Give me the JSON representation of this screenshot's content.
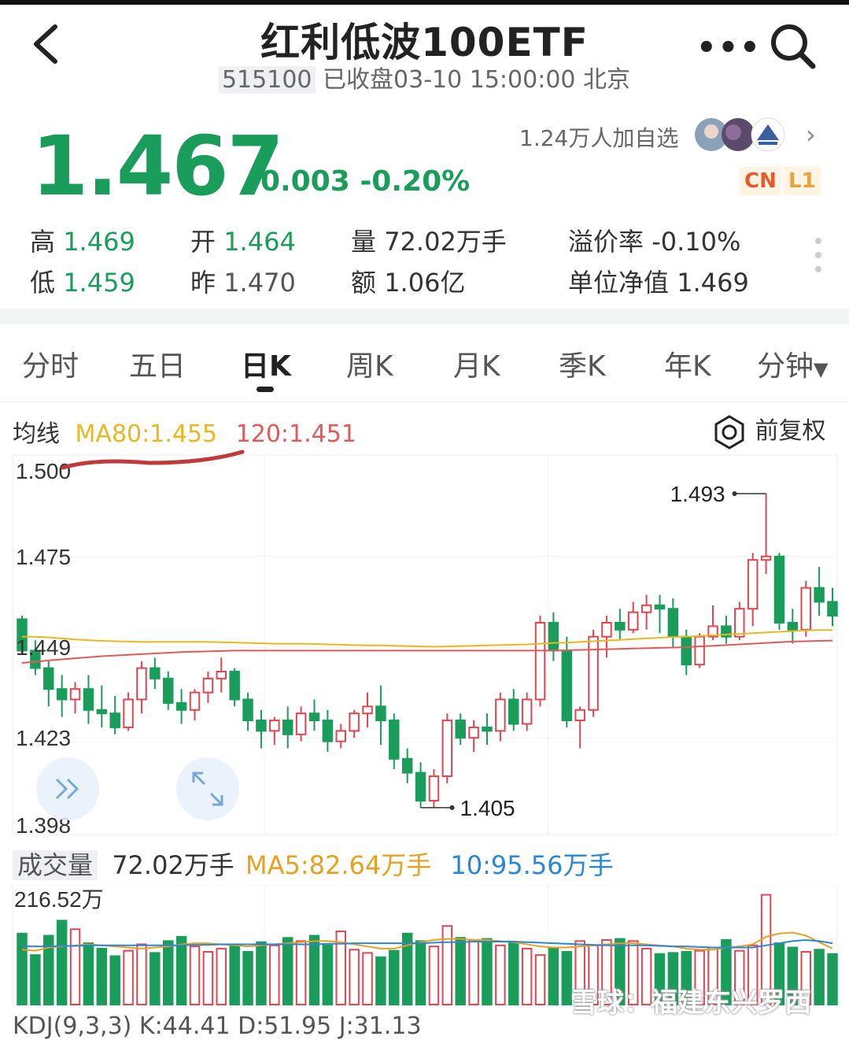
{
  "header": {
    "title": "红利低波100ETF",
    "code": "515100",
    "status": "已收盘03-10 15:00:00 北京"
  },
  "quote": {
    "price": "1.467",
    "change": "-0.003",
    "change_pct": "-0.20%",
    "followers": "1.24万人加自选",
    "badge_cn": "CN",
    "badge_l1": "L1"
  },
  "stats": {
    "high_label": "高",
    "high": "1.469",
    "open_label": "开",
    "open": "1.464",
    "volume_label": "量",
    "volume": "72.02万手",
    "premium_label": "溢价率",
    "premium": "-0.10%",
    "low_label": "低",
    "low": "1.459",
    "prev_label": "昨",
    "prev": "1.470",
    "amount_label": "额",
    "amount": "1.06亿",
    "nav_label": "单位净值",
    "nav": "1.469"
  },
  "tabs": [
    "分时",
    "五日",
    "日K",
    "周K",
    "月K",
    "季K",
    "年K",
    "分钟"
  ],
  "active_tab": "日K",
  "ma": {
    "label": "均线",
    "ma80": "MA80:1.455",
    "ma120": "120:1.451",
    "adjust": "前复权"
  },
  "colors": {
    "up": "#e04552",
    "down": "#1a9c5b",
    "ma80": "#e8b820",
    "ma120": "#e05a5a",
    "vol_ma10": "#2b86d6",
    "note": "#c0393b"
  },
  "chart_data": {
    "type": "candlestick",
    "y_ticks": [
      "1.500",
      "1.475",
      "1.449",
      "1.423",
      "1.398"
    ],
    "ylim": [
      1.398,
      1.5
    ],
    "max_label": "1.493",
    "min_label": "1.405",
    "candles": [
      [
        1.457,
        1.458,
        1.447,
        1.448
      ],
      [
        1.448,
        1.451,
        1.441,
        1.443
      ],
      [
        1.443,
        1.445,
        1.432,
        1.437
      ],
      [
        1.437,
        1.441,
        1.429,
        1.434
      ],
      [
        1.434,
        1.439,
        1.43,
        1.437
      ],
      [
        1.437,
        1.441,
        1.427,
        1.431
      ],
      [
        1.431,
        1.438,
        1.426,
        1.43
      ],
      [
        1.43,
        1.435,
        1.424,
        1.426
      ],
      [
        1.426,
        1.436,
        1.425,
        1.434
      ],
      [
        1.434,
        1.445,
        1.43,
        1.443
      ],
      [
        1.443,
        1.446,
        1.437,
        1.44
      ],
      [
        1.44,
        1.442,
        1.431,
        1.433
      ],
      [
        1.433,
        1.437,
        1.427,
        1.431
      ],
      [
        1.431,
        1.437,
        1.428,
        1.436
      ],
      [
        1.436,
        1.442,
        1.433,
        1.44
      ],
      [
        1.44,
        1.446,
        1.436,
        1.442
      ],
      [
        1.442,
        1.443,
        1.432,
        1.434
      ],
      [
        1.434,
        1.436,
        1.425,
        1.428
      ],
      [
        1.428,
        1.431,
        1.42,
        1.425
      ],
      [
        1.425,
        1.429,
        1.421,
        1.428
      ],
      [
        1.428,
        1.432,
        1.42,
        1.424
      ],
      [
        1.424,
        1.432,
        1.422,
        1.43
      ],
      [
        1.43,
        1.434,
        1.425,
        1.428
      ],
      [
        1.428,
        1.431,
        1.419,
        1.422
      ],
      [
        1.422,
        1.427,
        1.42,
        1.425
      ],
      [
        1.425,
        1.431,
        1.423,
        1.43
      ],
      [
        1.43,
        1.436,
        1.426,
        1.432
      ],
      [
        1.432,
        1.438,
        1.421,
        1.428
      ],
      [
        1.428,
        1.43,
        1.414,
        1.417
      ],
      [
        1.417,
        1.42,
        1.41,
        1.413
      ],
      [
        1.413,
        1.416,
        1.403,
        1.405
      ],
      [
        1.405,
        1.414,
        1.403,
        1.412
      ],
      [
        1.412,
        1.43,
        1.41,
        1.428
      ],
      [
        1.428,
        1.43,
        1.421,
        1.423
      ],
      [
        1.423,
        1.428,
        1.419,
        1.426
      ],
      [
        1.426,
        1.43,
        1.421,
        1.425
      ],
      [
        1.425,
        1.436,
        1.422,
        1.434
      ],
      [
        1.434,
        1.437,
        1.425,
        1.427
      ],
      [
        1.427,
        1.436,
        1.425,
        1.434
      ],
      [
        1.434,
        1.458,
        1.432,
        1.456
      ],
      [
        1.456,
        1.459,
        1.445,
        1.448
      ],
      [
        1.448,
        1.452,
        1.426,
        1.428
      ],
      [
        1.428,
        1.432,
        1.42,
        1.431
      ],
      [
        1.431,
        1.454,
        1.429,
        1.452
      ],
      [
        1.452,
        1.458,
        1.446,
        1.456
      ],
      [
        1.456,
        1.46,
        1.451,
        1.454
      ],
      [
        1.454,
        1.462,
        1.453,
        1.459
      ],
      [
        1.459,
        1.464,
        1.454,
        1.461
      ],
      [
        1.461,
        1.464,
        1.453,
        1.46
      ],
      [
        1.46,
        1.463,
        1.449,
        1.452
      ],
      [
        1.452,
        1.454,
        1.441,
        1.444
      ],
      [
        1.444,
        1.453,
        1.443,
        1.452
      ],
      [
        1.452,
        1.461,
        1.451,
        1.455
      ],
      [
        1.455,
        1.458,
        1.45,
        1.452
      ],
      [
        1.452,
        1.462,
        1.451,
        1.46
      ],
      [
        1.46,
        1.476,
        1.455,
        1.474
      ],
      [
        1.474,
        1.493,
        1.47,
        1.475
      ],
      [
        1.475,
        1.476,
        1.454,
        1.456
      ],
      [
        1.456,
        1.46,
        1.45,
        1.454
      ],
      [
        1.454,
        1.468,
        1.452,
        1.466
      ],
      [
        1.466,
        1.472,
        1.458,
        1.462
      ],
      [
        1.462,
        1.466,
        1.455,
        1.458
      ]
    ],
    "ma80": [
      1.452,
      1.452,
      1.4518,
      1.4515,
      1.4512,
      1.451,
      1.4508,
      1.4507,
      1.4506,
      1.4505,
      1.4505,
      1.4505,
      1.4505,
      1.4505,
      1.4505,
      1.4504,
      1.4503,
      1.4502,
      1.4501,
      1.45,
      1.45,
      1.45,
      1.4499,
      1.4498,
      1.4497,
      1.4496,
      1.4495,
      1.4495,
      1.4494,
      1.4493,
      1.4492,
      1.4491,
      1.4492,
      1.4493,
      1.4494,
      1.4495,
      1.4496,
      1.4497,
      1.4498,
      1.45,
      1.4502,
      1.4503,
      1.4505,
      1.4507,
      1.4509,
      1.4511,
      1.4513,
      1.4515,
      1.4517,
      1.4519,
      1.452,
      1.4522,
      1.4524,
      1.4526,
      1.4528,
      1.453,
      1.4532,
      1.4534,
      1.4536,
      1.4538,
      1.4539,
      1.4539
    ],
    "ma120": [
      1.4445,
      1.4448,
      1.4452,
      1.4455,
      1.4458,
      1.4461,
      1.4464,
      1.4466,
      1.4468,
      1.447,
      1.4472,
      1.4474,
      1.4476,
      1.4477,
      1.4478,
      1.4479,
      1.448,
      1.448,
      1.448,
      1.448,
      1.448,
      1.448,
      1.448,
      1.448,
      1.448,
      1.448,
      1.448,
      1.448,
      1.448,
      1.448,
      1.448,
      1.448,
      1.448,
      1.448,
      1.448,
      1.448,
      1.448,
      1.448,
      1.448,
      1.448,
      1.448,
      1.4481,
      1.4482,
      1.4483,
      1.4484,
      1.4485,
      1.4486,
      1.4487,
      1.4488,
      1.4489,
      1.449,
      1.4492,
      1.4494,
      1.4496,
      1.4498,
      1.45,
      1.4502,
      1.4504,
      1.4506,
      1.4507,
      1.4508,
      1.4509
    ],
    "volume_ticks": [
      "216.52万"
    ],
    "volume_max": 216.52,
    "volumes": [
      132,
      92,
      128,
      156,
      140,
      114,
      104,
      90,
      100,
      112,
      96,
      118,
      126,
      108,
      98,
      104,
      112,
      98,
      116,
      110,
      124,
      118,
      128,
      110,
      136,
      102,
      96,
      88,
      100,
      132,
      118,
      108,
      146,
      124,
      120,
      122,
      110,
      116,
      104,
      92,
      106,
      98,
      118,
      110,
      120,
      122,
      118,
      104,
      94,
      96,
      98,
      100,
      106,
      120,
      100,
      110,
      204,
      114,
      106,
      98,
      102,
      94
    ],
    "volume_ma5": [
      102,
      100,
      106,
      108,
      110,
      112,
      110,
      108,
      106,
      104,
      106,
      108,
      112,
      114,
      114,
      112,
      110,
      108,
      110,
      112,
      114,
      116,
      118,
      118,
      116,
      112,
      108,
      104,
      104,
      110,
      116,
      120,
      122,
      122,
      120,
      120,
      118,
      116,
      112,
      108,
      106,
      106,
      108,
      110,
      112,
      114,
      114,
      112,
      110,
      108,
      104,
      102,
      102,
      106,
      108,
      112,
      126,
      132,
      134,
      128,
      116,
      104
    ],
    "volume_ma10": [
      108,
      108,
      108,
      109,
      109,
      110,
      110,
      110,
      110,
      110,
      110,
      110,
      110,
      111,
      111,
      112,
      112,
      112,
      112,
      112,
      112,
      112,
      112,
      113,
      113,
      114,
      114,
      114,
      114,
      114,
      114,
      115,
      116,
      116,
      117,
      117,
      117,
      117,
      116,
      115,
      114,
      113,
      112,
      111,
      110,
      110,
      110,
      110,
      109,
      108,
      108,
      107,
      106,
      106,
      106,
      106,
      110,
      114,
      118,
      120,
      118,
      114
    ]
  },
  "volume": {
    "label": "成交量",
    "value": "72.02万手",
    "ma5": "MA5:82.64万手",
    "ma10": "10:95.56万手"
  },
  "kdj": {
    "text": "KDJ(9,3,3) K:44.41 D:51.95 J:31.13"
  },
  "watermark": "雪球：福建东兴罗西",
  "icons": [
    "back-icon",
    "more-icon",
    "search-icon",
    "ring-icon",
    "double-chevron-icon",
    "expand-icon"
  ]
}
